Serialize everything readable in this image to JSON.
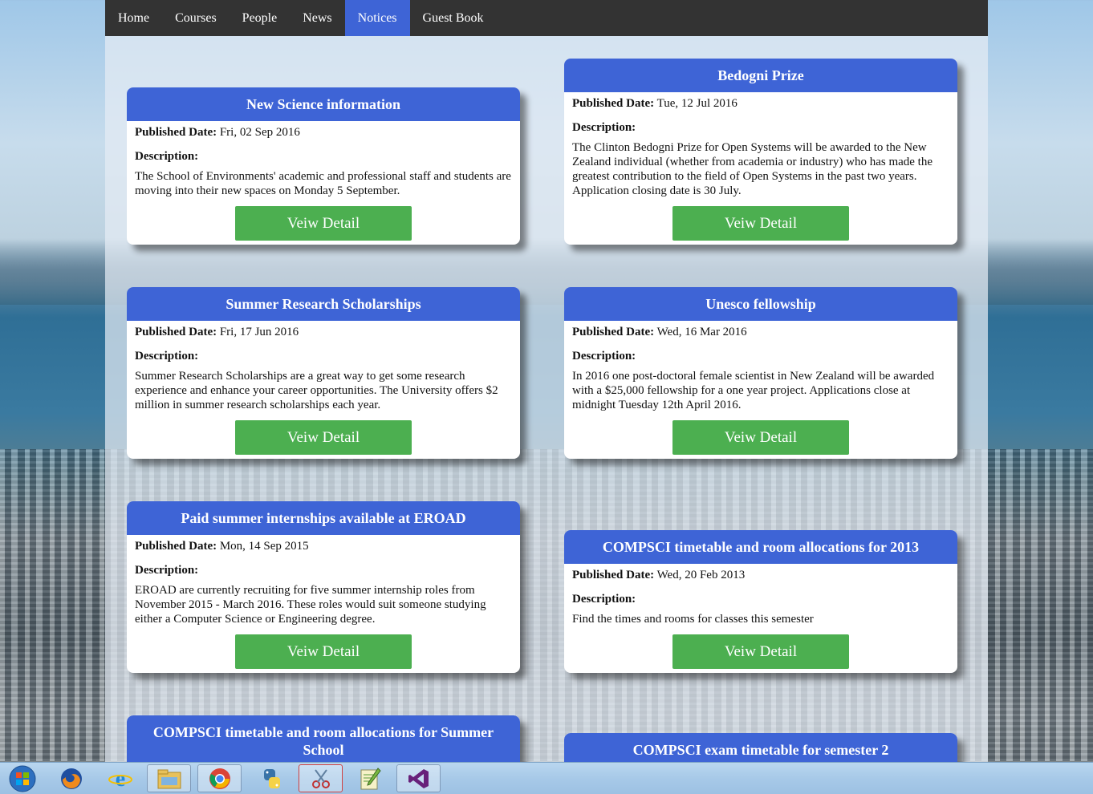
{
  "nav": {
    "items": [
      {
        "label": "Home"
      },
      {
        "label": "Courses"
      },
      {
        "label": "People"
      },
      {
        "label": "News"
      },
      {
        "label": "Notices",
        "active": true
      },
      {
        "label": "Guest Book"
      }
    ]
  },
  "labels": {
    "published": "Published Date:",
    "description": "Description:",
    "button": "Veiw Detail"
  },
  "notices": [
    {
      "title": "New Science information",
      "date": "Fri, 02 Sep 2016",
      "description": "The School of Environments' academic and professional staff and students are moving into their new spaces on Monday 5 September."
    },
    {
      "title": "Bedogni Prize",
      "date": "Tue, 12 Jul 2016",
      "description": "The Clinton Bedogni Prize for Open Systems will be awarded to the New Zealand individual (whether from academia or industry) who has made the greatest contribution to the field of Open Systems in the past two years. Application closing date is 30 July."
    },
    {
      "title": "Summer Research Scholarships",
      "date": "Fri, 17 Jun 2016",
      "description": "Summer Research Scholarships are a great way to get some research experience and enhance your career opportunities. The University offers $2 million in summer research scholarships each year."
    },
    {
      "title": "Unesco fellowship",
      "date": "Wed, 16 Mar 2016",
      "description": "In 2016 one post-doctoral female scientist in New Zealand will be awarded with a $25,000 fellowship for a one year project. Applications close at midnight Tuesday 12th April 2016."
    },
    {
      "title": "Paid summer internships available at EROAD",
      "date": "Mon, 14 Sep 2015",
      "description": "EROAD are currently recruiting for five summer internship roles from November 2015 - March 2016. These roles would suit someone studying either a Computer Science or Engineering degree."
    },
    {
      "title": "COMPSCI timetable and room allocations for 2013",
      "date": "Wed, 20 Feb 2013",
      "description": "Find the times and rooms for classes this semester"
    },
    {
      "title": "COMPSCI timetable and room allocations for Summer School"
    },
    {
      "title": "COMPSCI exam timetable for semester 2"
    }
  ],
  "taskbar": {
    "items": [
      {
        "icon": "windows-start-icon"
      },
      {
        "icon": "firefox-icon"
      },
      {
        "icon": "internet-explorer-icon"
      },
      {
        "icon": "file-explorer-icon"
      },
      {
        "icon": "chrome-icon"
      },
      {
        "icon": "python-icon"
      },
      {
        "icon": "snipping-tool-icon"
      },
      {
        "icon": "notepad-plus-icon"
      },
      {
        "icon": "visual-studio-icon"
      }
    ]
  },
  "colors": {
    "nav_bg": "#333333",
    "nav_active": "#3e64d6",
    "card_header": "#3e64d6",
    "button": "#4caf50"
  }
}
